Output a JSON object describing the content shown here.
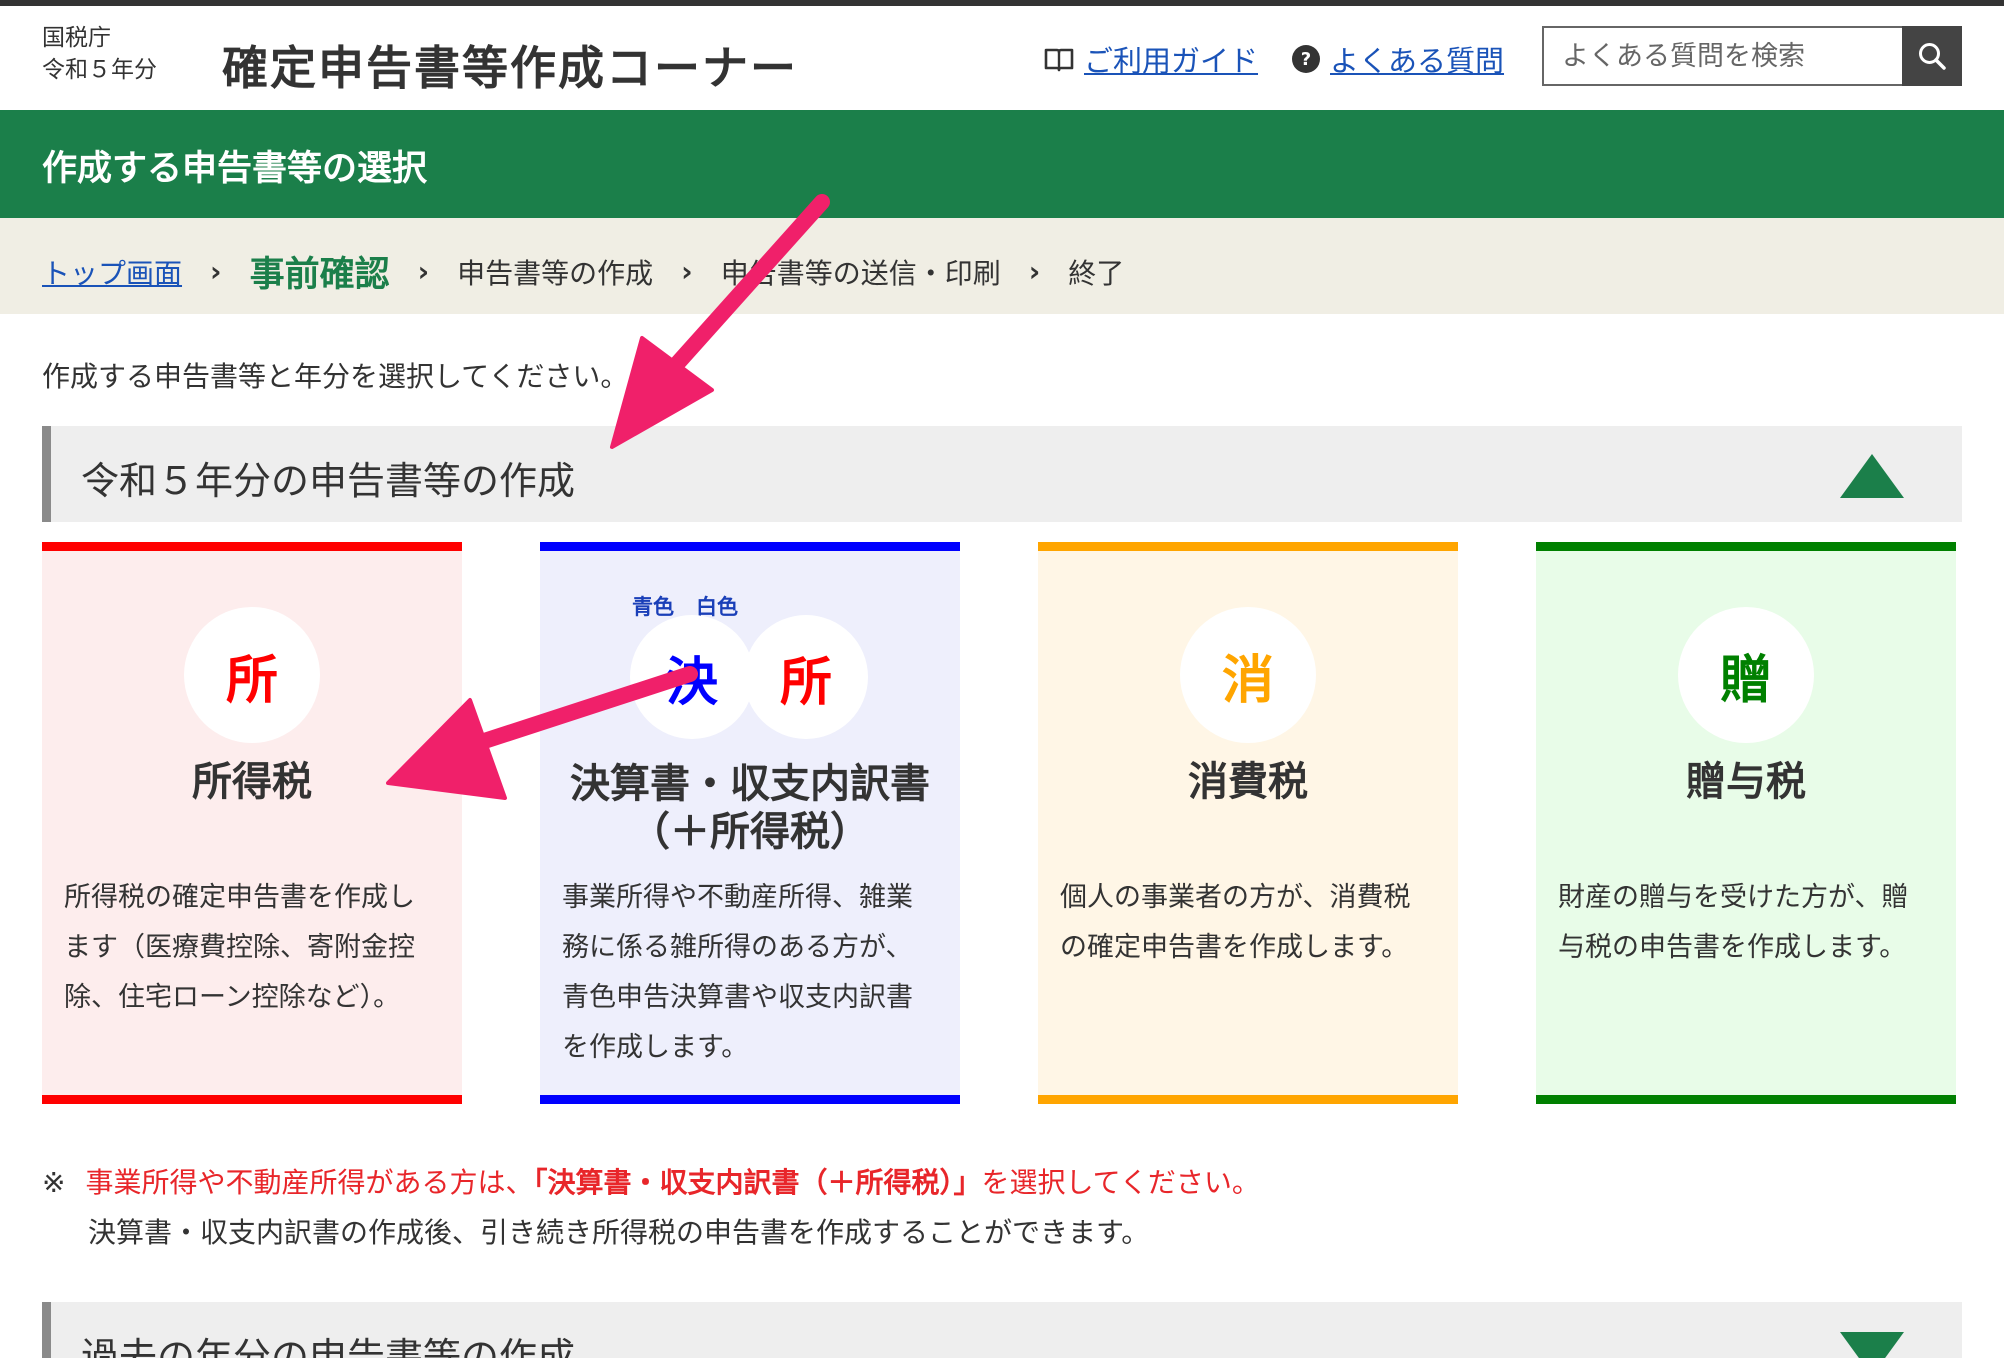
{
  "header": {
    "agency": "国税庁",
    "year": "令和５年分",
    "site_title": "確定申告書等作成コーナー",
    "guide_link": "ご利用ガイド",
    "faq_link": "よくある質問",
    "search_placeholder": "よくある質問を検索"
  },
  "page_title": "作成する申告書等の選択",
  "breadcrumb": {
    "items": [
      {
        "label": "トップ画面",
        "state": "link"
      },
      {
        "label": "事前確認",
        "state": "current"
      },
      {
        "label": "申告書等の作成",
        "state": "pending"
      },
      {
        "label": "申告書等の送信・印刷",
        "state": "pending"
      },
      {
        "label": "終了",
        "state": "pending"
      }
    ],
    "separator": "›"
  },
  "instruction": "作成する申告書等と年分を選択してください。",
  "section_current": {
    "title": "令和５年分の申告書等の作成",
    "expanded": true
  },
  "cards": [
    {
      "badge": "所",
      "title": "所得税",
      "description": "所得税の確定申告書を作成します（医療費控除、寄附金控除、住宅ローン控除など）。",
      "accent": "#ff0000",
      "background": "#fdeded"
    },
    {
      "badges": [
        "決",
        "所"
      ],
      "badge_labels": [
        "青色",
        "白色"
      ],
      "title_line1": "決算書・収支内訳書",
      "title_line2": "（＋所得税）",
      "description": "事業所得や不動産所得、雑業務に係る雑所得のある方が、青色申告決算書や収支内訳書を作成します。",
      "accent": "#0000ff",
      "background": "#eeeffc"
    },
    {
      "badge": "消",
      "title": "消費税",
      "description": "個人の事業者の方が、消費税の確定申告書を作成します。",
      "accent": "#ffa500",
      "background": "#fff6e6"
    },
    {
      "badge": "贈",
      "title": "贈与税",
      "description": "財産の贈与を受けた方が、贈与税の申告書を作成します。",
      "accent": "#008000",
      "background": "#e8fce8"
    }
  ],
  "note": {
    "mark": "※",
    "part1": "事業所得や不動産所得がある方は、",
    "emphasis": "「決算書・収支内訳書（＋所得税）」",
    "part2": "を選択してください。",
    "line2": "決算書・収支内訳書の作成後、引き続き所得税の申告書を作成することができます。"
  },
  "section_past": {
    "title": "過去の年分の申告書等の作成",
    "expanded": false
  },
  "colors": {
    "brand_green": "#1b7f4a",
    "link_blue": "#1a53b8",
    "annotation_arrow": "#f0206a",
    "note_red": "#e8262a"
  }
}
